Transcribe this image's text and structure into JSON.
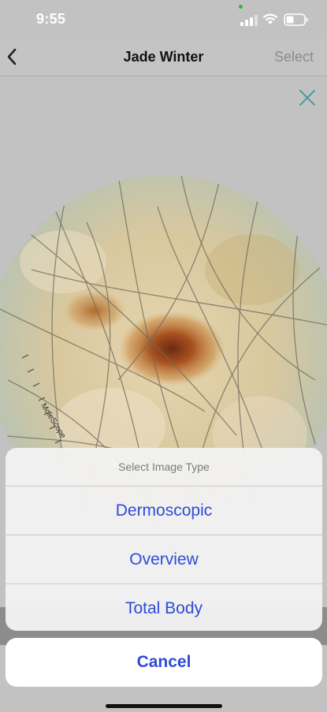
{
  "status_bar": {
    "time": "9:55",
    "battery_icon": "battery-icon",
    "wifi_icon": "wifi-icon",
    "signal_icon": "signal-icon"
  },
  "navbar": {
    "title": "Jade Winter",
    "select_label": "Select",
    "back_icon": "chevron-left-icon"
  },
  "viewer": {
    "close_icon": "close-icon",
    "image_watermark": "MoleScope"
  },
  "action_sheet": {
    "title": "Select Image Type",
    "options": [
      "Dermoscopic",
      "Overview",
      "Total Body"
    ],
    "cancel_label": "Cancel"
  },
  "colors": {
    "accent": "#2f4bd6",
    "close_icon": "#4a9aa0",
    "background": "#c2c2c2"
  }
}
